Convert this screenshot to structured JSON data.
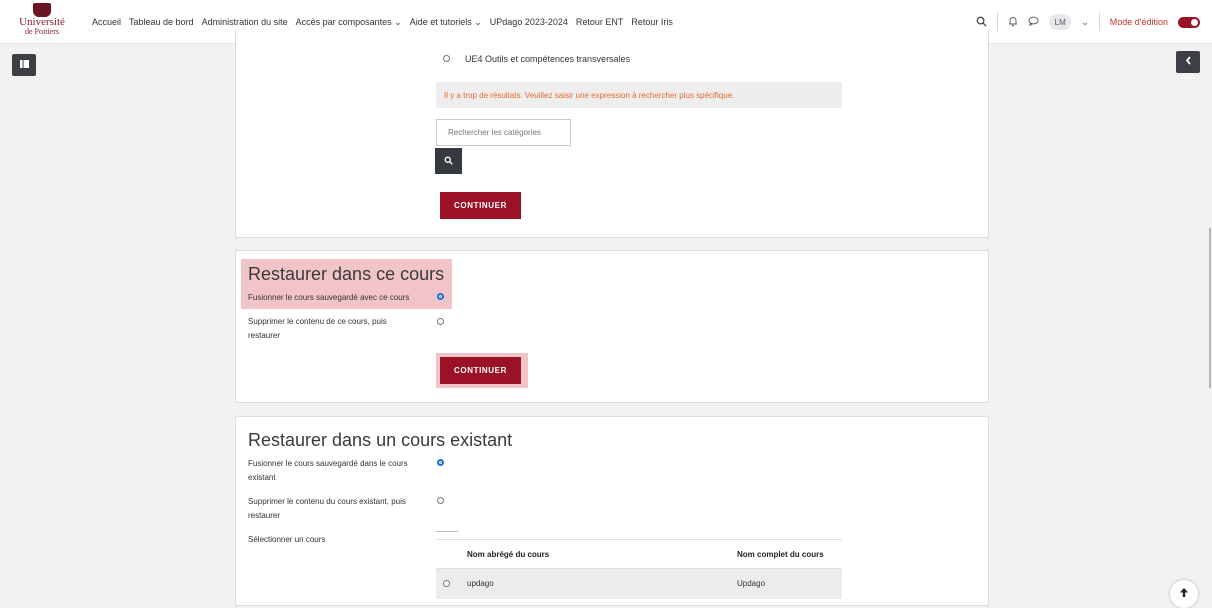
{
  "logo": {
    "line1": "Université",
    "line2": "de Poitiers"
  },
  "nav": {
    "links": [
      "Accueil",
      "Tableau de bord",
      "Administration du site",
      "Accès par composantes ⌄",
      "Aide et tutoriels ⌄",
      "UPdago 2023-2024",
      "Retour ENT",
      "Retour Iris"
    ],
    "avatar": "LM",
    "avatar_chevron": "⌄",
    "edit_mode_label": "Mode d'édition"
  },
  "icons": {
    "search": "search-icon",
    "bell": "bell-icon",
    "chat": "chat-icon",
    "drawer": "drawer-icon",
    "chevron_left": "chevron-left-icon",
    "arrow_up": "arrow-up-icon"
  },
  "category": {
    "option_label": "UE4 Outils et compétences transversales",
    "warning": "Il y a trop de résultats. Veuillez saisir une expression à rechercher plus spécifique.",
    "search_placeholder": "Rechercher les catégories",
    "continue_label": "CONTINUER"
  },
  "this_course": {
    "title": "Restaurer dans ce cours",
    "option_merge": "Fusionner le cours sauvegardé avec ce cours",
    "option_delete_line1": "Supprimer le contenu de ce cours, puis",
    "option_delete_line2": "restaurer",
    "continue_label": "CONTINUER"
  },
  "existing_course": {
    "title": "Restaurer dans un cours existant",
    "option_merge_line1": "Fusionner le cours sauvegardé dans le cours",
    "option_merge_line2": "existant",
    "option_delete_line1": "Supprimer le contenu du cours existant, puis",
    "option_delete_line2": "restaurer",
    "select_label": "Sélectionner un cours",
    "table": {
      "headers": [
        "Nom abrégé du cours",
        "Nom complet du cours"
      ],
      "rows": [
        {
          "short": "updago",
          "full": "Updago"
        }
      ]
    }
  },
  "colors": {
    "accent": "#9b1227",
    "highlight": "#f1c4c8",
    "warning": "#e8692c",
    "radio_selected": "#1a6fd6"
  }
}
